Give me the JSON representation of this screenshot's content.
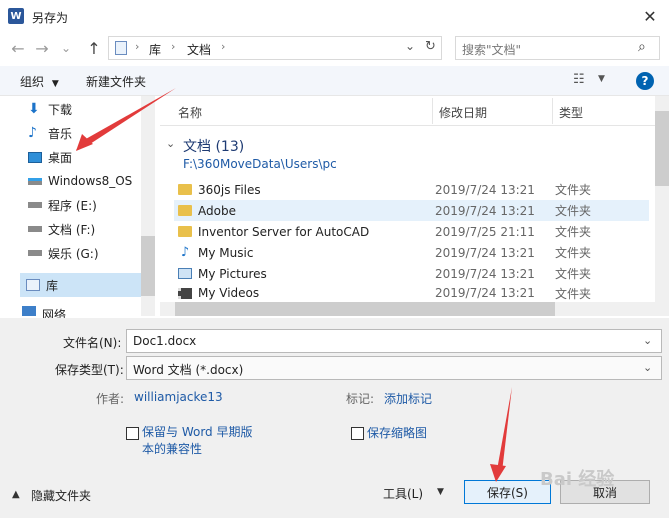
{
  "window": {
    "title": "另存为",
    "app_icon_letter": "W",
    "close_glyph": "✕"
  },
  "nav": {
    "back_glyph": "←",
    "forward_glyph": "→",
    "recent_glyph": "⌄",
    "up_glyph": "↑",
    "breadcrumb": [
      "库",
      "文档"
    ],
    "crumb_sep": "›",
    "refresh_glyph": "↻",
    "search_placeholder": "搜索\"文档\"",
    "search_icon": "⌕"
  },
  "toolbar": {
    "organize_label": "组织",
    "new_folder_label": "新建文件夹",
    "view_glyph": "☷",
    "help_glyph": "?"
  },
  "sidebar": {
    "items": [
      {
        "label": "下载",
        "icon": "download-icon"
      },
      {
        "label": "音乐",
        "icon": "music-icon"
      },
      {
        "label": "桌面",
        "icon": "desktop-icon"
      },
      {
        "label": "Windows8_OS",
        "icon": "drive-icon"
      },
      {
        "label": "程序 (E:)",
        "icon": "drive-icon"
      },
      {
        "label": "文档 (F:)",
        "icon": "drive-icon"
      },
      {
        "label": "娱乐 (G:)",
        "icon": "drive-icon"
      }
    ],
    "selected_label": "库",
    "network_label": "网络"
  },
  "columns": {
    "name": "名称",
    "date": "修改日期",
    "type": "类型"
  },
  "group": {
    "title": "文档 (13)",
    "path": "F:\\360MoveData\\Users\\pc"
  },
  "files": [
    {
      "name": "360js Files",
      "date": "2019/7/24 13:21",
      "type": "文件夹",
      "icon": "folder-icon"
    },
    {
      "name": "Adobe",
      "date": "2019/7/24 13:21",
      "type": "文件夹",
      "icon": "folder-icon"
    },
    {
      "name": "Inventor Server for AutoCAD",
      "date": "2019/7/25 21:11",
      "type": "文件夹",
      "icon": "folder-icon"
    },
    {
      "name": "My Music",
      "date": "2019/7/24 13:21",
      "type": "文件夹",
      "icon": "music-icon"
    },
    {
      "name": "My Pictures",
      "date": "2019/7/24 13:21",
      "type": "文件夹",
      "icon": "pictures-icon"
    },
    {
      "name": "My Videos",
      "date": "2019/7/24 13:21",
      "type": "文件夹",
      "icon": "videos-icon"
    }
  ],
  "form": {
    "filename_label": "文件名(N):",
    "filename_value": "Doc1.docx",
    "filetype_label": "保存类型(T):",
    "filetype_value": "Word 文档 (*.docx)",
    "author_label": "作者:",
    "author_value": "williamjacke13",
    "tags_label": "标记:",
    "tags_value": "添加标记",
    "compat_label_line1": "保留与 Word 早期版",
    "compat_label_line2": "本的兼容性",
    "thumb_label": "保存缩略图"
  },
  "footer": {
    "hide_folders_label": "隐藏文件夹",
    "tools_label": "工具(L)",
    "save_label": "保存(S)",
    "cancel_label": "取消"
  },
  "watermark": "Bai 经验",
  "colors": {
    "accent": "#0078d7",
    "arrow": "#e23b3b",
    "folder": "#e9c04b",
    "link": "#1e5aa6"
  }
}
